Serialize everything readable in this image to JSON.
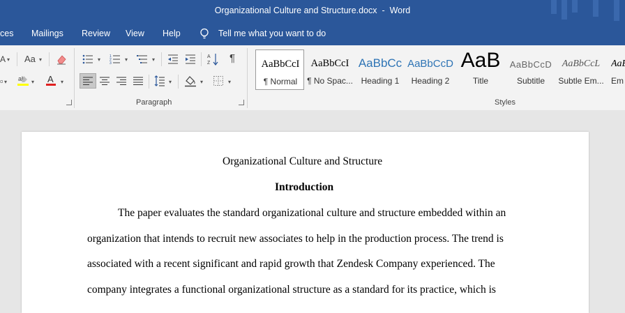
{
  "window": {
    "title": "Organizational Culture and Structure.docx  -  Word"
  },
  "menu": {
    "references_partial": "ces",
    "mailings": "Mailings",
    "review": "Review",
    "view": "View",
    "help": "Help",
    "tell_me": "Tell me what you want to do"
  },
  "ribbon": {
    "paragraph_label": "Paragraph",
    "styles_label": "Styles",
    "change_case_glyph": "Aa",
    "styles": [
      {
        "sample": "AaBbCcI",
        "label": "¶ Normal"
      },
      {
        "sample": "AaBbCcI",
        "label": "¶ No Spac..."
      },
      {
        "sample": "AaBbCc",
        "label": "Heading 1"
      },
      {
        "sample": "AaBbCcD",
        "label": "Heading 2"
      },
      {
        "sample": "AaB",
        "label": "Title"
      },
      {
        "sample": "AaBbCcD",
        "label": "Subtitle"
      },
      {
        "sample": "AaBbCcL",
        "label": "Subtle Em..."
      },
      {
        "sample": "AaBl",
        "label": "Em"
      }
    ]
  },
  "document": {
    "title": "Organizational Culture and Structure",
    "heading": "Introduction",
    "lines": [
      "The paper evaluates the standard organizational culture and structure embedded within an",
      "organization that intends to recruit new associates to help in the production process. The trend is",
      "associated with a recent significant and rapid growth that Zendesk Company experienced. The",
      "company integrates a functional organizational structure as a standard for its practice, which is"
    ]
  },
  "colors": {
    "titlebar": "#2b579a",
    "ribbon": "#f3f3f3",
    "canvas": "#e6e6e6",
    "heading_blue": "#2e74b5",
    "highlight_yellow": "#ffff00",
    "font_red": "#e02020"
  }
}
